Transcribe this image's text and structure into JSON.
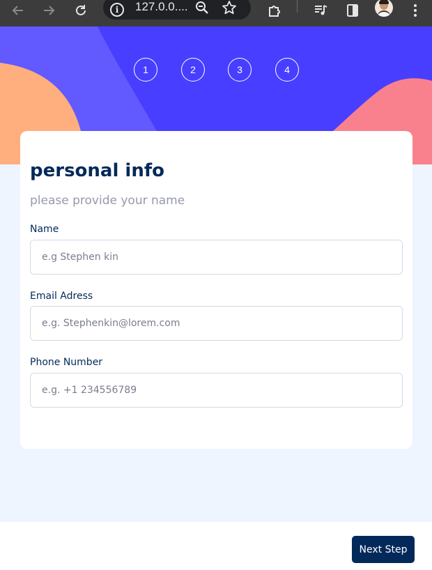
{
  "browser": {
    "url_text": "127.0.0....",
    "icons": [
      "back-arrow-icon",
      "forward-arrow-icon",
      "reload-icon",
      "site-info-icon",
      "zoom-icon",
      "bookmark-star-icon",
      "extensions-icon",
      "media-controls-icon",
      "side-panel-icon",
      "profile-avatar",
      "kebab-menu-icon"
    ]
  },
  "steps": [
    "1",
    "2",
    "3",
    "4"
  ],
  "form": {
    "title": "personal info",
    "subtitle": "please provide your name",
    "fields": [
      {
        "label": "Name",
        "value": "",
        "placeholder": "e.g Stephen kin"
      },
      {
        "label": "Email Adress",
        "value": "",
        "placeholder": "e.g. Stephenkin@lorem.com"
      },
      {
        "label": "Phone Number",
        "value": "",
        "placeholder": "e.g. +1 234556789"
      }
    ]
  },
  "footer": {
    "next_label": "Next Step"
  },
  "colors": {
    "header_bg": "#483eff",
    "header_light": "#6259ff",
    "blob_orange": "#ffaf7e",
    "blob_pink": "#f9818e",
    "marine_blue": "#02295a",
    "page_bg": "#eef5ff",
    "border": "#d6d9e6",
    "cool_gray": "#9699ab"
  }
}
